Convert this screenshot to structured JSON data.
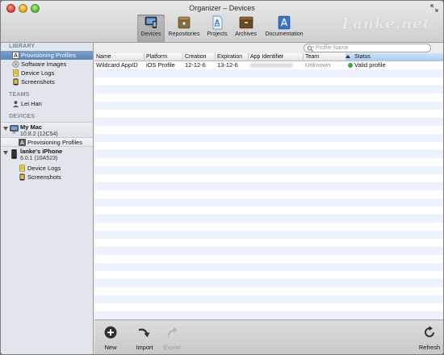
{
  "window": {
    "title": "Organizer – Devices",
    "watermark": "Lanke.net"
  },
  "toolbar": {
    "items": [
      {
        "label": "Devices",
        "icon": "devices-icon",
        "active": true
      },
      {
        "label": "Repositories",
        "icon": "repositories-icon"
      },
      {
        "label": "Projects",
        "icon": "projects-icon"
      },
      {
        "label": "Archives",
        "icon": "archives-icon"
      },
      {
        "label": "Documentation",
        "icon": "documentation-icon"
      }
    ]
  },
  "search": {
    "placeholder": "Profile Name"
  },
  "sidebar": {
    "library_header": "LIBRARY",
    "library": [
      {
        "label": "Provisioning Profiles",
        "icon": "provisioning-profile-icon",
        "selected": true
      },
      {
        "label": "Software Images",
        "icon": "software-images-icon"
      },
      {
        "label": "Device Logs",
        "icon": "device-logs-icon"
      },
      {
        "label": "Screenshots",
        "icon": "screenshots-icon"
      }
    ],
    "teams_header": "TEAMS",
    "teams": [
      {
        "label": "Lei Han",
        "icon": "person-icon"
      }
    ],
    "devices_header": "DEVICES",
    "devices": [
      {
        "name": "My Mac",
        "detail": "10.8.2 (12C54)",
        "icon": "imac-icon",
        "children": [
          {
            "label": "Provisioning Profiles",
            "icon": "provisioning-profile-icon"
          }
        ]
      },
      {
        "name": "lanke's iPhone",
        "detail": "6.0.1 (10A523)",
        "icon": "iphone-icon",
        "children": [
          {
            "label": "Device Logs",
            "icon": "device-logs-icon"
          },
          {
            "label": "Screenshots",
            "icon": "screenshots-icon"
          }
        ]
      }
    ]
  },
  "table": {
    "columns": [
      "Name",
      "Platform",
      "Creation",
      "Expiration",
      "App Identifier",
      "Team",
      "Status"
    ],
    "sorted_column": "Status",
    "rows": [
      {
        "name": "Wildcard AppID",
        "platform": "iOS Profile",
        "creation": "12-12-6",
        "expiration": "13-12-6",
        "app_identifier": "xxxxxxxxxxxxxx",
        "team": "Unknown",
        "status": "Valid profile"
      }
    ]
  },
  "bottombar": {
    "new_label": "New",
    "import_label": "Import",
    "export_label": "Export",
    "refresh_label": "Refresh"
  },
  "colors": {
    "selection": "#5c84b9",
    "sidebar_bg": "#e1e6ec",
    "row_alt": "#edf3fe",
    "status_ok": "#3aa93a"
  }
}
